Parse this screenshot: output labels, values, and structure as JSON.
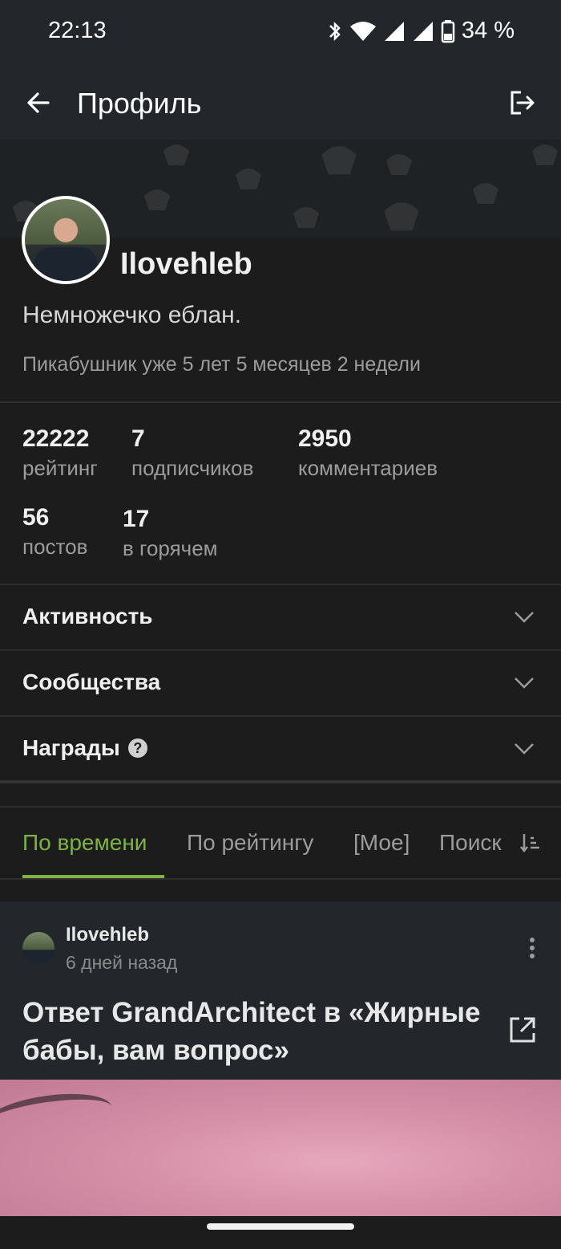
{
  "status_bar": {
    "time": "22:13",
    "battery": "34 %",
    "icons": [
      "bluetooth-icon",
      "wifi-icon",
      "signal-icon",
      "signal-icon",
      "battery-icon"
    ]
  },
  "app_bar": {
    "title": "Профиль",
    "back_icon": "arrow-left-icon",
    "logout_icon": "logout-icon"
  },
  "profile": {
    "username": "Ilovehleb",
    "bio": "Немножечко еблан.",
    "member_since": "Пикабушник уже 5 лет 5 месяцев 2 недели"
  },
  "stats": [
    {
      "value": "22222",
      "label": "рейтинг"
    },
    {
      "value": "7",
      "label": "подписчиков"
    },
    {
      "value": "2950",
      "label": "комментариев"
    },
    {
      "value": "56",
      "label": "постов"
    },
    {
      "value": "17",
      "label": "в горячем"
    }
  ],
  "sections": [
    {
      "label": "Активность"
    },
    {
      "label": "Сообщества"
    },
    {
      "label": "Награды"
    }
  ],
  "tabs": [
    {
      "label": "По времени",
      "active": true
    },
    {
      "label": "По рейтингу",
      "active": false
    },
    {
      "label": "[Мое]",
      "active": false
    },
    {
      "label": "Поиск",
      "active": false
    }
  ],
  "post": {
    "author": "Ilovehleb",
    "time": "6 дней назад",
    "title": "Ответ GrandArchitect в «Жирные бабы, вам вопрос»"
  },
  "colors": {
    "accent": "#7cb342",
    "background": "#1c1c1c",
    "bar": "#23272b"
  }
}
